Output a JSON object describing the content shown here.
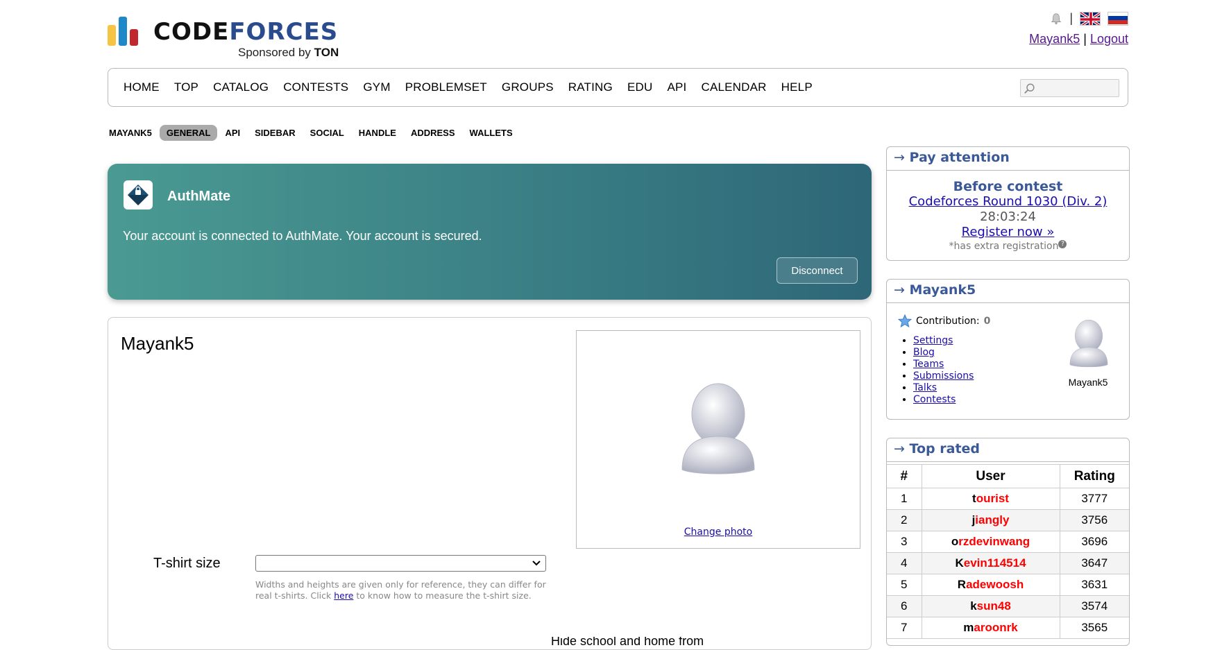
{
  "logo": {
    "word_a": "CODE",
    "word_b": "FORCES",
    "sponsor_prefix": "Sponsored by",
    "sponsor_name": "TON"
  },
  "header": {
    "separator": "|",
    "username": "Mayank5",
    "logout": "Logout",
    "bell_icon": "bell-icon",
    "flag_en": "flag-uk-icon",
    "flag_ru": "flag-ru-icon"
  },
  "main_nav": [
    "HOME",
    "TOP",
    "CATALOG",
    "CONTESTS",
    "GYM",
    "PROBLEMSET",
    "GROUPS",
    "RATING",
    "EDU",
    "API",
    "CALENDAR",
    "HELP"
  ],
  "search": {
    "placeholder": "",
    "icon": "search-icon"
  },
  "sub_nav": {
    "tabs": [
      "MAYANK5",
      "GENERAL",
      "API",
      "SIDEBAR",
      "SOCIAL",
      "HANDLE",
      "ADDRESS",
      "WALLETS"
    ],
    "active": "GENERAL"
  },
  "authmate": {
    "title": "AuthMate",
    "message": "Your account is connected to AuthMate. Your account is secured.",
    "button": "Disconnect",
    "colors": {
      "gradient_start": "#4a9a92",
      "gradient_end": "#2e6778"
    }
  },
  "profile": {
    "name": "Mayank5",
    "change_photo": "Change photo",
    "tshirt_label": "T-shirt size",
    "tshirt_value": "",
    "hint_before": "Widths and heights are given only for reference, they can differ for real t-shirts. Click ",
    "hint_link": "here",
    "hint_after": " to know how to measure the t-shirt size.",
    "cut_off_text": "Hide school and home from"
  },
  "pay_attention": {
    "title": "Pay attention",
    "arrow": "→",
    "heading": "Before contest",
    "contest": "Codeforces Round 1030 (Div. 2)",
    "timer": "28:03:24",
    "register": "Register now »",
    "note": "*has extra registration",
    "note_icon": "?"
  },
  "user_box": {
    "title": "Mayank5",
    "arrow": "→",
    "contribution_label": "Contribution:",
    "contribution_value": "0",
    "links": [
      "Settings",
      "Blog",
      "Teams",
      "Submissions",
      "Talks",
      "Contests"
    ],
    "avatar_name": "Mayank5"
  },
  "top_rated": {
    "title": "Top rated",
    "arrow": "→",
    "columns": [
      "#",
      "User",
      "Rating"
    ],
    "rows": [
      {
        "rank": "1",
        "first": "t",
        "rest": "ourist",
        "rating": "3777"
      },
      {
        "rank": "2",
        "first": "j",
        "rest": "iangly",
        "rating": "3756"
      },
      {
        "rank": "3",
        "first": "o",
        "rest": "rzdevinwang",
        "rating": "3696"
      },
      {
        "rank": "4",
        "first": "K",
        "rest": "evin114514",
        "rating": "3647"
      },
      {
        "rank": "5",
        "first": "R",
        "rest": "adewoosh",
        "rating": "3631"
      },
      {
        "rank": "6",
        "first": "k",
        "rest": "sun48",
        "rating": "3574"
      },
      {
        "rank": "7",
        "first": "m",
        "rest": "aroonrk",
        "rating": "3565"
      }
    ]
  }
}
